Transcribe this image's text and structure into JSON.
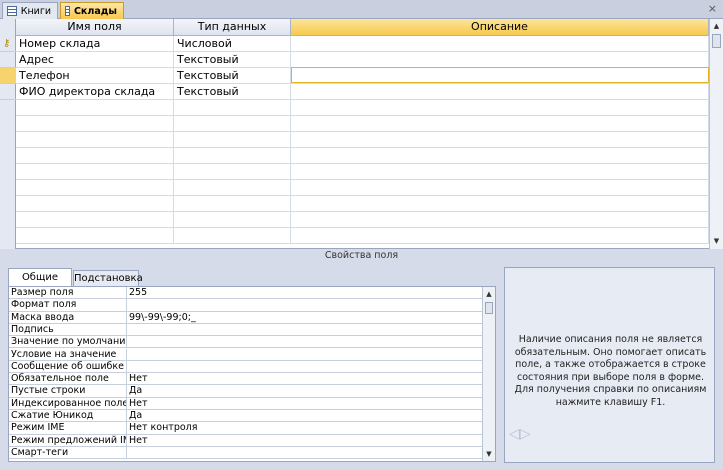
{
  "tabs": [
    {
      "label": "Книги",
      "active": false
    },
    {
      "label": "Склады",
      "active": true
    }
  ],
  "close_glyph": "×",
  "grid": {
    "headers": {
      "field_name": "Имя поля",
      "data_type": "Тип данных",
      "description": "Описание"
    },
    "rows": [
      {
        "name": "Номер склада",
        "type": "Числовой",
        "description": "",
        "primary_key": true
      },
      {
        "name": "Адрес",
        "type": "Текстовый",
        "description": ""
      },
      {
        "name": "Телефон",
        "type": "Текстовый",
        "description": "",
        "current": true
      },
      {
        "name": "ФИО директора склада",
        "type": "Текстовый",
        "description": ""
      }
    ]
  },
  "properties": {
    "section_title": "Свойства поля",
    "tabs": {
      "general": "Общие",
      "lookup": "Подстановка"
    },
    "items": [
      {
        "name": "Размер поля",
        "value": "255"
      },
      {
        "name": "Формат поля",
        "value": ""
      },
      {
        "name": "Маска ввода",
        "value": "99\\-99\\-99;0;_"
      },
      {
        "name": "Подпись",
        "value": ""
      },
      {
        "name": "Значение по умолчанию",
        "value": ""
      },
      {
        "name": "Условие на значение",
        "value": ""
      },
      {
        "name": "Сообщение об ошибке",
        "value": ""
      },
      {
        "name": "Обязательное поле",
        "value": "Нет"
      },
      {
        "name": "Пустые строки",
        "value": "Да"
      },
      {
        "name": "Индексированное поле",
        "value": "Нет"
      },
      {
        "name": "Сжатие Юникод",
        "value": "Да"
      },
      {
        "name": "Режим IME",
        "value": "Нет контроля"
      },
      {
        "name": "Режим предложений IME",
        "value": "Нет"
      },
      {
        "name": "Смарт-теги",
        "value": ""
      }
    ]
  },
  "help": {
    "text": "Наличие описания поля не является обязательным. Оно помогает описать поле, а также отображается в строке состояния при выборе поля в форме. Для получения справки по описаниям нажмите клавишу F1."
  },
  "icons": {
    "table_icon": "table-icon",
    "key_icon": "primary-key-icon",
    "up_arrow": "▲",
    "down_arrow": "▼"
  }
}
